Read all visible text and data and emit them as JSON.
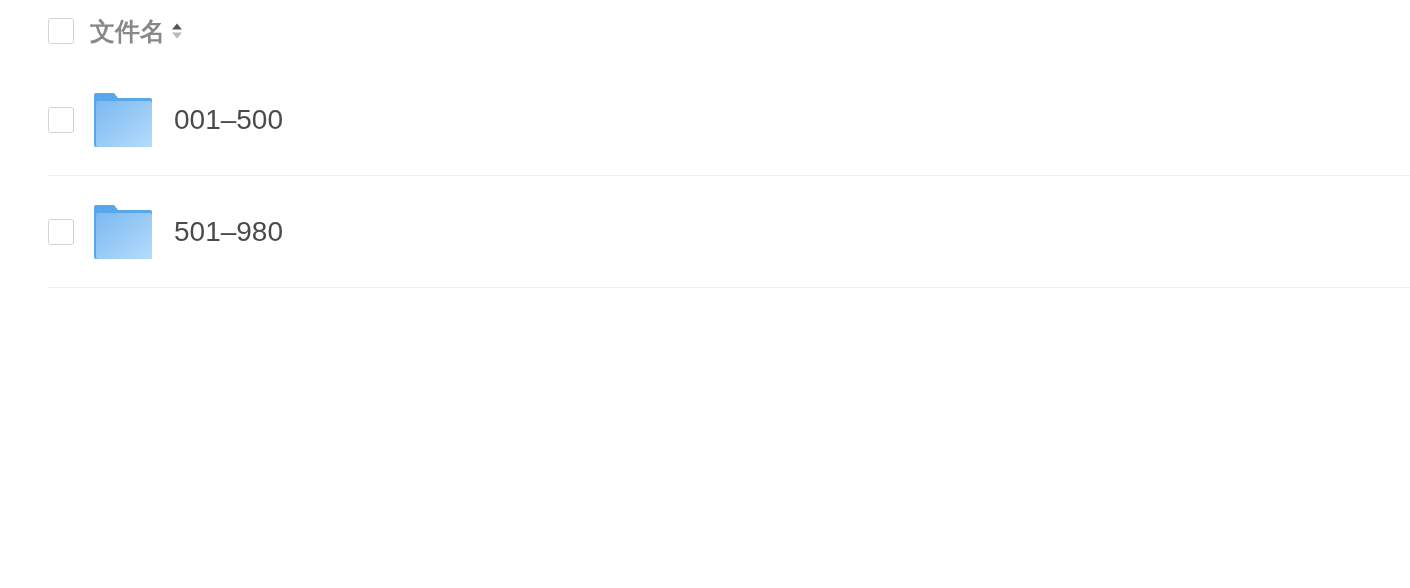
{
  "header": {
    "checked": false,
    "label": "文件名",
    "sorted_ascending": true
  },
  "rows": [
    {
      "name": "001–500",
      "checked": false
    },
    {
      "name": "501–980",
      "checked": false
    }
  ]
}
